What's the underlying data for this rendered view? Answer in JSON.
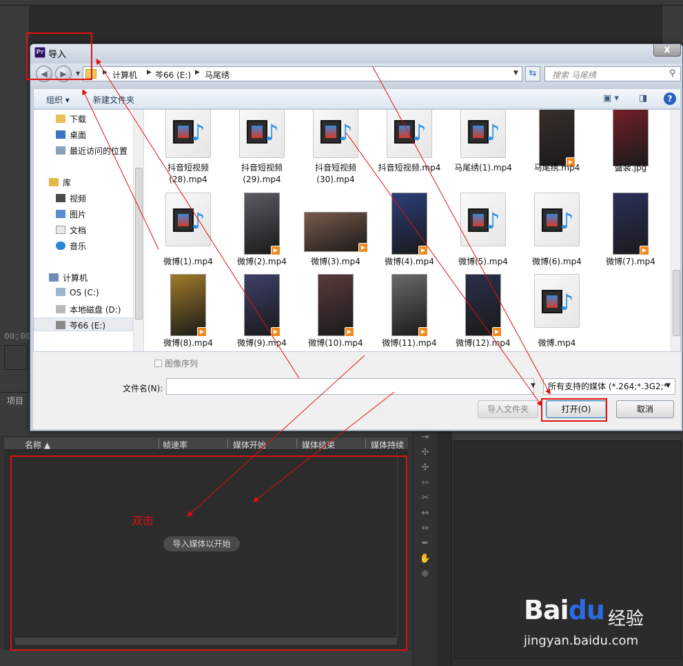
{
  "dialog": {
    "title": "导入",
    "close": "x",
    "breadcrumb": [
      "计算机",
      "芩66 (E:)",
      "马尾绣"
    ],
    "search_placeholder": "搜索 马尾绣",
    "toolbar": {
      "organize": "组织 ▾",
      "new_folder": "新建文件夹"
    },
    "nav": {
      "downloads": "下载",
      "desktop": "桌面",
      "recent": "最近访问的位置",
      "libraries": "库",
      "videos": "视频",
      "pictures": "图片",
      "documents": "文档",
      "music": "音乐",
      "computer": "计算机",
      "drive_c": "OS (C:)",
      "drive_d": "本地磁盘 (D:)",
      "drive_e": "芩66 (E:)"
    },
    "files": [
      {
        "name": "抖音短视频\n(28).mp4",
        "kind": "doc"
      },
      {
        "name": "抖音短视频\n(29).mp4",
        "kind": "doc"
      },
      {
        "name": "抖音短视频\n(30).mp4",
        "kind": "doc"
      },
      {
        "name": "抖音短视频.mp4",
        "kind": "doc"
      },
      {
        "name": "马尾绣(1).mp4",
        "kind": "doc"
      },
      {
        "name": "马尾绣.mp4",
        "kind": "photo"
      },
      {
        "name": "盛装.jpg",
        "kind": "photo"
      },
      {
        "name": "微博(1).mp4",
        "kind": "doc"
      },
      {
        "name": "微博(2).mp4",
        "kind": "photo"
      },
      {
        "name": "微博(3).mp4",
        "kind": "photo"
      },
      {
        "name": "微博(4).mp4",
        "kind": "photo"
      },
      {
        "name": "微博(5).mp4",
        "kind": "doc"
      },
      {
        "name": "微博(6).mp4",
        "kind": "doc"
      },
      {
        "name": "微博(7).mp4",
        "kind": "photo"
      },
      {
        "name": "微博(8).mp4",
        "kind": "photo"
      },
      {
        "name": "微博(9).mp4",
        "kind": "photo"
      },
      {
        "name": "微博(10).mp4",
        "kind": "photo"
      },
      {
        "name": "微博(11).mp4",
        "kind": "photo"
      },
      {
        "name": "微博(12).mp4",
        "kind": "photo"
      },
      {
        "name": "微博.mp4",
        "kind": "doc"
      }
    ],
    "image_sequence": "图像序列",
    "filename_label": "文件名(N):",
    "filename_value": "",
    "filter": "所有支持的媒体 (*.264;*.3G2;*",
    "buttons": {
      "import_folder": "导入文件夹",
      "open": "打开(O)",
      "cancel": "取消"
    }
  },
  "project_panel": {
    "title": "项目",
    "columns": [
      "名称 ▲",
      "帧速率",
      "媒体开始",
      "媒体结束",
      "媒体持续"
    ],
    "hint": "导入媒体以开始"
  },
  "background": {
    "timecode": "00;00"
  },
  "annotation": {
    "double_click": "双击"
  },
  "watermark": {
    "logo_bai": "Bai",
    "logo_du": "du",
    "logo_jy": "经验",
    "url": "jingyan.baidu.com"
  },
  "colors": {
    "annotation_red": "#e01010",
    "dialog_frame": "#c9d1dc",
    "pr_dark": "#2b2b2b"
  }
}
